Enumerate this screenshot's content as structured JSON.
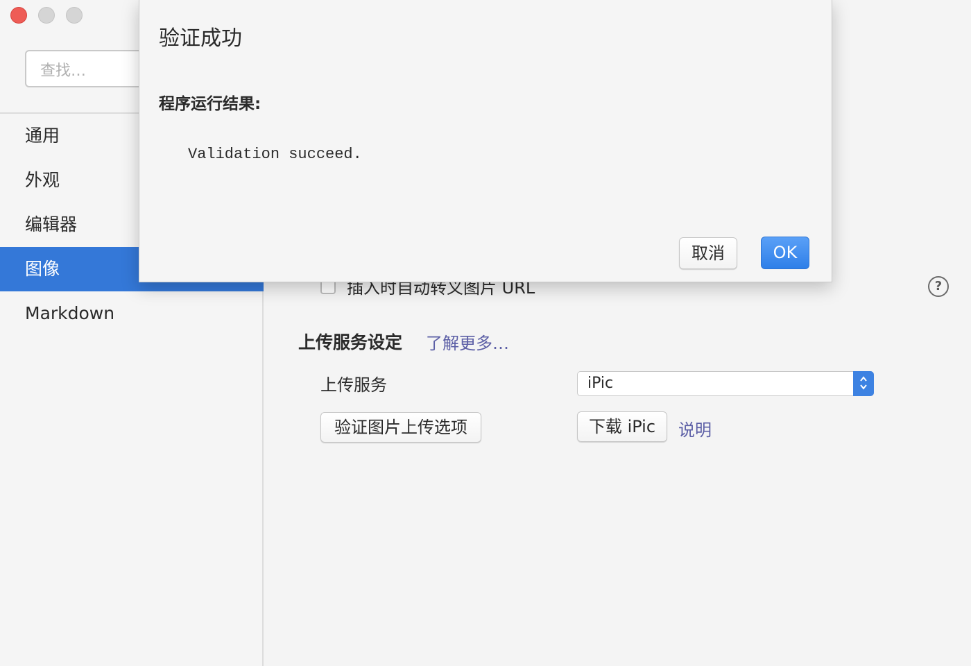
{
  "sidebar": {
    "search_placeholder": "查找…",
    "items": [
      {
        "label": "通用"
      },
      {
        "label": "外观"
      },
      {
        "label": "编辑器"
      },
      {
        "label": "图像"
      },
      {
        "label": "Markdown"
      }
    ],
    "active_item": "图像"
  },
  "main": {
    "checkbox_label": "插入时自动转义图片 URL",
    "section_title": "上传服务设定",
    "learn_more": "了解更多…",
    "upload_service_label": "上传服务",
    "upload_service_value": "iPic",
    "validate_button": "验证图片上传选项",
    "download_button": "下载 iPic",
    "docs_link": "说明"
  },
  "dialog": {
    "title": "验证成功",
    "result_label": "程序运行结果:",
    "output": "Validation succeed.",
    "cancel": "取消",
    "ok": "OK"
  },
  "colors": {
    "accent": "#3478d8",
    "link": "#5c5fa6",
    "close": "#ee5c56"
  },
  "icons": {
    "help": "question-circle-icon",
    "select": "up-down-chevron-icon"
  }
}
